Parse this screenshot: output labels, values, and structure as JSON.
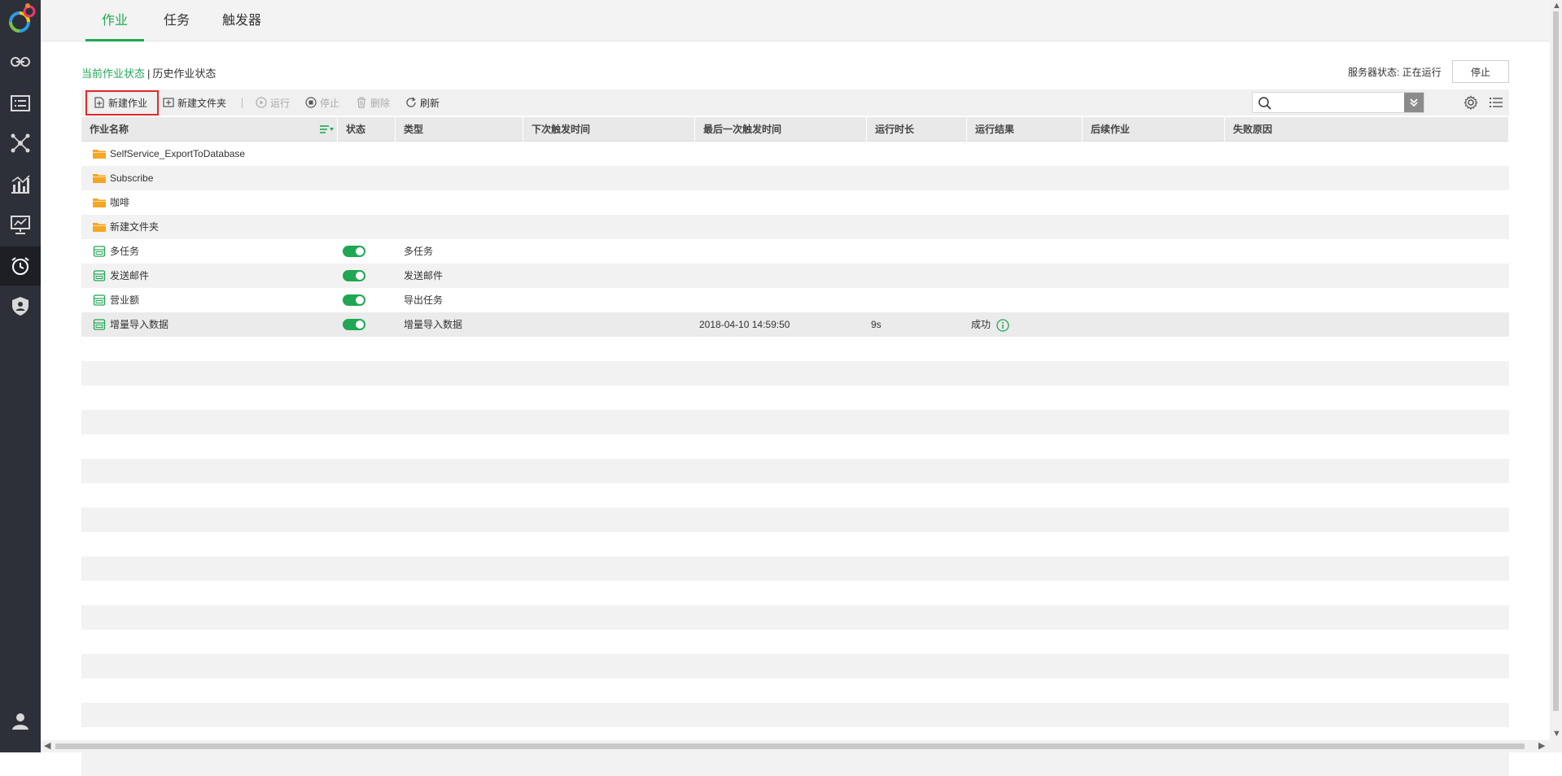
{
  "sidebar": {
    "items": [
      {
        "icon": "link-icon"
      },
      {
        "icon": "list-card-icon"
      },
      {
        "icon": "network-icon"
      },
      {
        "icon": "chart-analysis-icon"
      },
      {
        "icon": "presentation-icon"
      },
      {
        "icon": "alarm-clock-icon"
      },
      {
        "icon": "shield-user-icon"
      }
    ],
    "user_icon": "user-icon"
  },
  "tabs": [
    {
      "label": "作业",
      "active": true
    },
    {
      "label": "任务",
      "active": false
    },
    {
      "label": "触发器",
      "active": false
    }
  ],
  "status_links": {
    "current": "当前作业状态",
    "separator": "|",
    "history": "历史作业状态"
  },
  "server": {
    "status_text": "服务器状态: 正在运行",
    "stop_label": "停止"
  },
  "toolbar": {
    "new_job": "新建作业",
    "new_folder": "新建文件夹",
    "run": "运行",
    "stop": "停止",
    "delete": "删除",
    "refresh": "刷新",
    "search_placeholder": ""
  },
  "table": {
    "columns": [
      "作业名称",
      "状态",
      "类型",
      "下次触发时间",
      "最后一次触发时间",
      "运行时长",
      "运行结果",
      "后续作业",
      "失败原因"
    ],
    "rows": [
      {
        "kind": "folder",
        "name": "SelfService_ExportToDatabase",
        "type": "",
        "last": "",
        "duration": "",
        "result": ""
      },
      {
        "kind": "folder",
        "name": "Subscribe",
        "type": "",
        "last": "",
        "duration": "",
        "result": ""
      },
      {
        "kind": "folder",
        "name": "咖啡",
        "type": "",
        "last": "",
        "duration": "",
        "result": ""
      },
      {
        "kind": "folder",
        "name": "新建文件夹",
        "type": "",
        "last": "",
        "duration": "",
        "result": ""
      },
      {
        "kind": "job",
        "name": "多任务",
        "type": "多任务",
        "last": "",
        "duration": "",
        "result": ""
      },
      {
        "kind": "job",
        "name": "发送邮件",
        "type": "发送邮件",
        "last": "",
        "duration": "",
        "result": ""
      },
      {
        "kind": "job",
        "name": "营业额",
        "type": "导出任务",
        "last": "",
        "duration": "",
        "result": ""
      },
      {
        "kind": "job",
        "name": "增量导入数据",
        "type": "增量导入数据",
        "last": "2018-04-10 14:59:50",
        "duration": "9s",
        "result": "成功"
      }
    ]
  },
  "colors": {
    "accent": "#20a754",
    "sidebar": "#2d3038",
    "folder": "#f5a623",
    "highlight": "#e02b2b"
  }
}
